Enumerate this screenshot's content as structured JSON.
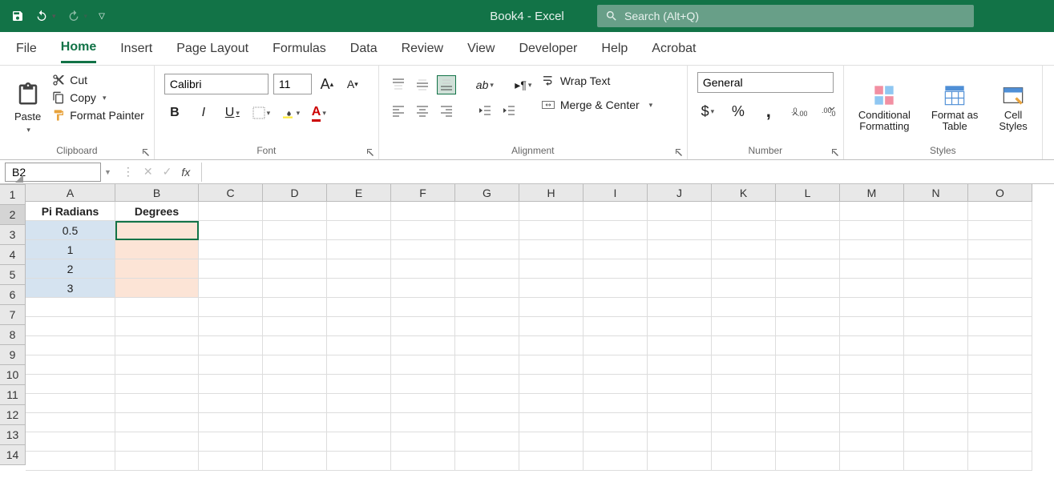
{
  "title": "Book4  -  Excel",
  "search": {
    "placeholder": "Search (Alt+Q)"
  },
  "tabs": [
    "File",
    "Home",
    "Insert",
    "Page Layout",
    "Formulas",
    "Data",
    "Review",
    "View",
    "Developer",
    "Help",
    "Acrobat"
  ],
  "activeTab": "Home",
  "clipboard": {
    "paste": "Paste",
    "cut": "Cut",
    "copy": "Copy",
    "fmt": "Format Painter",
    "label": "Clipboard"
  },
  "font": {
    "name": "Calibri",
    "size": "11",
    "bold": "B",
    "italic": "I",
    "underline": "U",
    "label": "Font"
  },
  "align": {
    "wrap": "Wrap Text",
    "merge": "Merge & Center",
    "label": "Alignment"
  },
  "number": {
    "format": "General",
    "label": "Number"
  },
  "styles": {
    "cond": "Conditional\nFormatting",
    "tbl": "Format as\nTable",
    "cell": "Cell\nStyles",
    "label": "Styles"
  },
  "namebox": "B2",
  "columns": [
    "A",
    "B",
    "C",
    "D",
    "E",
    "F",
    "G",
    "H",
    "I",
    "J",
    "K",
    "L",
    "M",
    "N",
    "O"
  ],
  "rowCount": 14,
  "sheet": {
    "A1": "Pi Radians",
    "B1": "Degrees",
    "A2": "0.5",
    "A3": "1",
    "A4": "2",
    "A5": "3"
  },
  "selectedCell": "B2"
}
